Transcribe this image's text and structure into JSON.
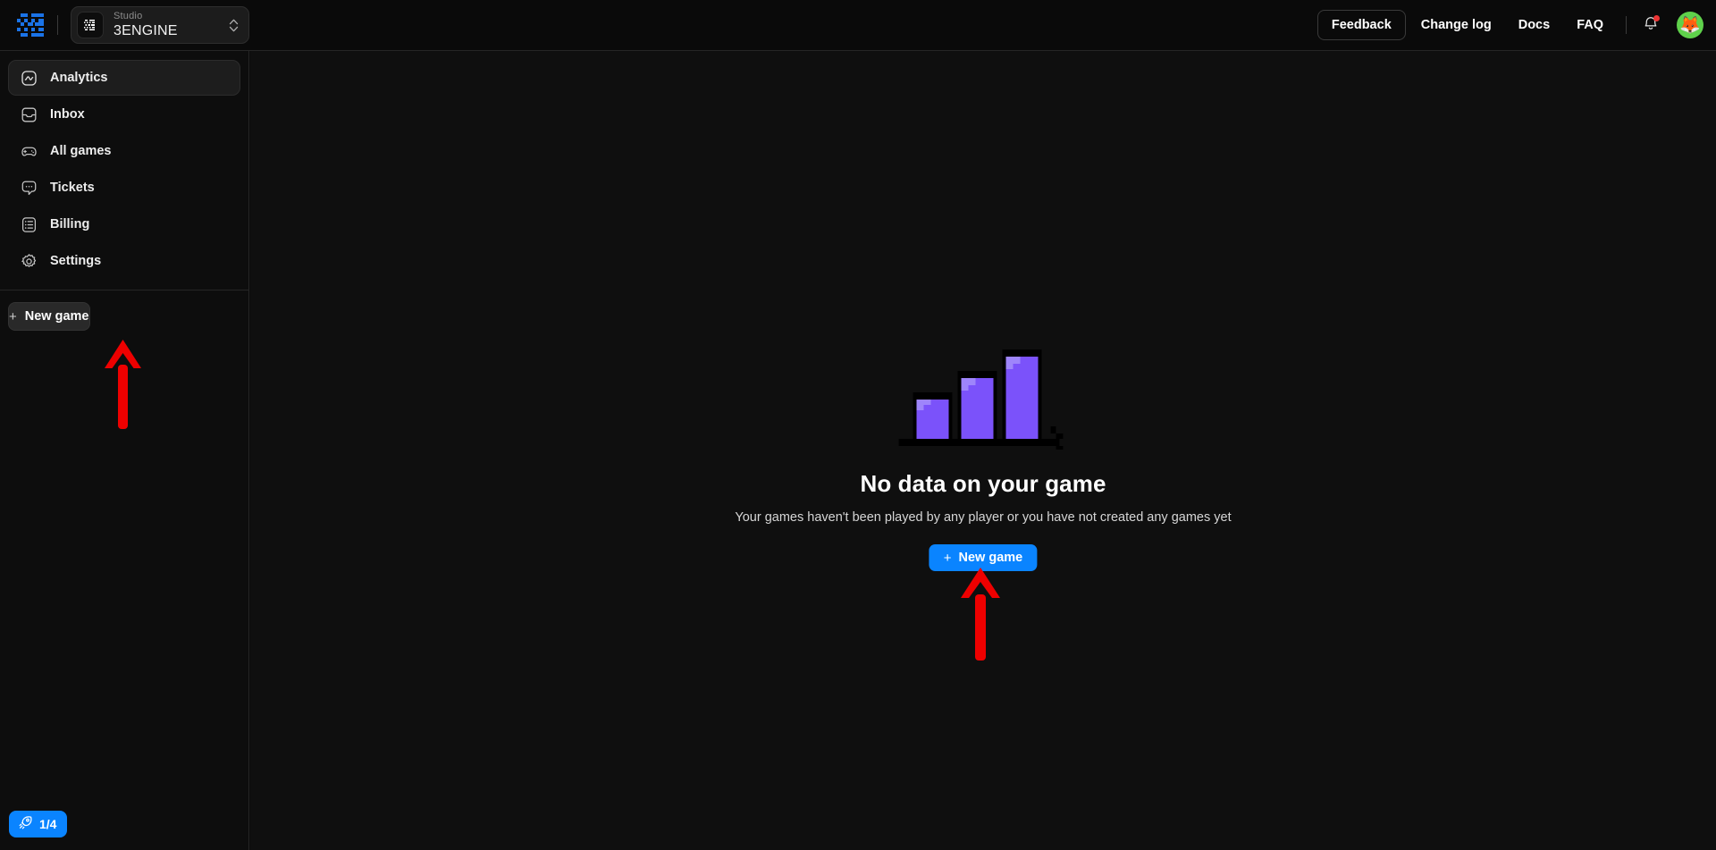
{
  "colors": {
    "accent_blue": "#0a84ff",
    "brand_blue": "#1a73e8",
    "bar_purple": "#7b52fa",
    "bar_purple_highlight": "#9e85fb",
    "avatar_green": "#5fd14b",
    "annotation_red": "#ee0000",
    "notification_red": "#ec3434",
    "page_bg": "#0f0f0f",
    "sidebar_bg": "#0d0d0d",
    "topbar_bg": "#0a0a0a"
  },
  "topbar": {
    "logo_icon": "3engine-pixel-logo-icon",
    "studio_selector": {
      "mark_icon": "3e-monogram-icon",
      "label": "Studio",
      "value": "3ENGINE",
      "chevron_icon": "chevron-up-down-icon"
    },
    "feedback_label": "Feedback",
    "links": [
      {
        "label": "Change log",
        "name": "nav-link-change-log"
      },
      {
        "label": "Docs",
        "name": "nav-link-docs"
      },
      {
        "label": "FAQ",
        "name": "nav-link-faq"
      }
    ],
    "bell_icon": "bell-icon",
    "bell_has_notification": true,
    "avatar_emoji": "🦊"
  },
  "sidebar": {
    "items": [
      {
        "label": "Analytics",
        "icon": "analytics-icon",
        "active": true
      },
      {
        "label": "Inbox",
        "icon": "inbox-icon",
        "active": false
      },
      {
        "label": "All games",
        "icon": "gamepad-icon",
        "active": false
      },
      {
        "label": "Tickets",
        "icon": "ticket-chat-icon",
        "active": false
      },
      {
        "label": "Billing",
        "icon": "billing-list-icon",
        "active": false
      },
      {
        "label": "Settings",
        "icon": "gear-icon",
        "active": false
      }
    ],
    "new_game_label": "New game",
    "new_game_plus": "+",
    "onboarding_badge": {
      "icon": "rocket-icon",
      "text": "1/4"
    }
  },
  "main": {
    "empty_state": {
      "illustration_icon": "pixel-bar-chart-icon",
      "title": "No data on your game",
      "subtitle": "Your games haven't been played by any player or you have not created any games yet",
      "button_plus": "+",
      "button_label": "New game"
    }
  },
  "annotations": [
    {
      "name": "annotation-arrow-sidebar-new-game",
      "points_to": "sidebar new-game button",
      "color": "#ee0000"
    },
    {
      "name": "annotation-arrow-center-new-game",
      "points_to": "empty state new-game button",
      "color": "#ee0000"
    }
  ]
}
